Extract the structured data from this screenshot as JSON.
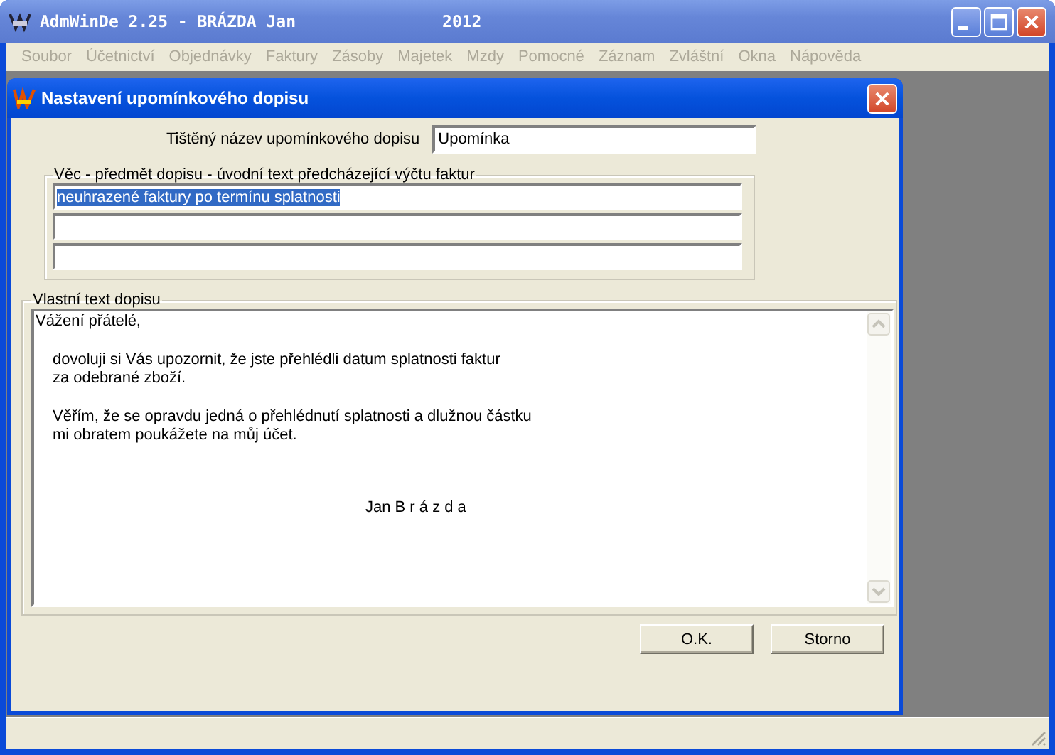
{
  "window": {
    "title": "AdmWinDe 2.25 - BRÁZDA Jan",
    "year": "2012"
  },
  "menu": [
    {
      "label": "Soubor",
      "disabled": true
    },
    {
      "label": "Účetnictví",
      "disabled": true
    },
    {
      "label": "Objednávky",
      "disabled": true
    },
    {
      "label": "Faktury",
      "disabled": true
    },
    {
      "label": "Zásoby",
      "disabled": true
    },
    {
      "label": "Majetek",
      "disabled": true
    },
    {
      "label": "Mzdy",
      "disabled": true
    },
    {
      "label": "Pomocné",
      "disabled": true
    },
    {
      "label": "Záznam",
      "disabled": true
    },
    {
      "label": "Zvláštní",
      "disabled": true
    },
    {
      "label": "Okna",
      "disabled": true
    },
    {
      "label": "Nápověda",
      "disabled": true
    }
  ],
  "dialog": {
    "title": "Nastavení upomínkového dopisu",
    "printed_name": {
      "label": "Tištěný název upomínkového dopisu",
      "value": "Upomínka"
    },
    "subject": {
      "legend": "Věc - předmět dopisu - úvodní text předcházející výčtu faktur",
      "fields": [
        {
          "value": "neuhrazené faktury po termínu splatnosti",
          "highlighted": true
        }
      ]
    },
    "letter": {
      "legend": "Vlastní text dopisu",
      "paragraphs": [
        {
          "kind": "plain",
          "lines": [
            "Vážení přátelé,"
          ]
        },
        {
          "kind": "indented",
          "lines": [
            "dovoluji si Vás upozornit, že jste přehlédli datum splatnosti faktur",
            "za odebrané zboží."
          ]
        },
        {
          "kind": "indented",
          "lines": [
            "Věřím, že se opravdu jedná o přehlédnutí splatnosti a dlužnou částku",
            "mi obratem poukážete na můj účet."
          ]
        },
        {
          "kind": "signature",
          "lines": [
            "Jan B r á z d a"
          ]
        }
      ]
    },
    "buttons": [
      "O.K.",
      "Storno"
    ]
  }
}
